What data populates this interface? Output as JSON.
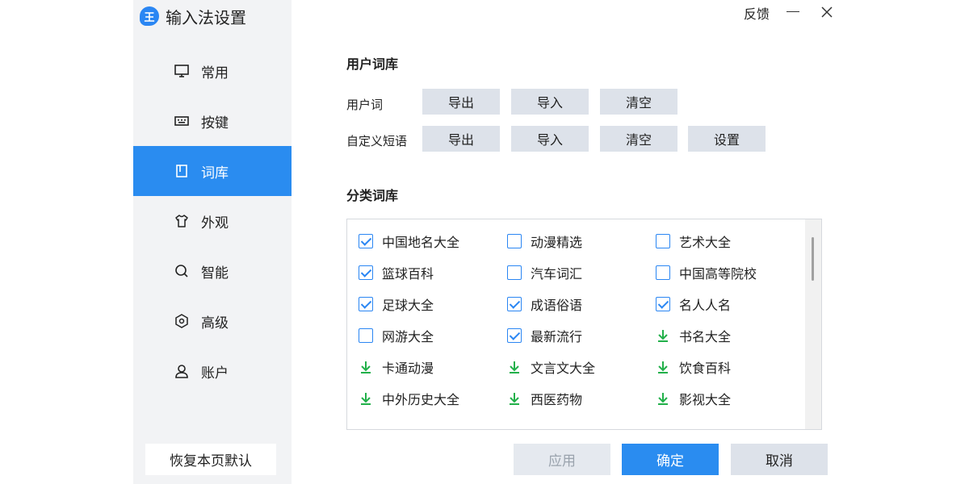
{
  "app": {
    "title": "输入法设置",
    "logo_text": "王"
  },
  "topbar": {
    "feedback": "反馈"
  },
  "sidebar": {
    "items": [
      {
        "label": "常用",
        "icon": "monitor-icon"
      },
      {
        "label": "按键",
        "icon": "keyboard-icon"
      },
      {
        "label": "词库",
        "icon": "book-icon",
        "active": true
      },
      {
        "label": "外观",
        "icon": "shirt-icon"
      },
      {
        "label": "智能",
        "icon": "search-icon"
      },
      {
        "label": "高级",
        "icon": "hexagon-icon"
      },
      {
        "label": "账户",
        "icon": "user-icon"
      }
    ],
    "restore_label": "恢复本页默认"
  },
  "user_lib": {
    "title": "用户词库",
    "rows": [
      {
        "label": "用户词",
        "buttons": [
          "导出",
          "导入",
          "清空"
        ]
      },
      {
        "label": "自定义短语",
        "buttons": [
          "导出",
          "导入",
          "清空",
          "设置"
        ]
      }
    ]
  },
  "category_lib": {
    "title": "分类词库",
    "items": [
      {
        "label": "中国地名大全",
        "state": "checked"
      },
      {
        "label": "动漫精选",
        "state": "unchecked"
      },
      {
        "label": "艺术大全",
        "state": "unchecked"
      },
      {
        "label": "篮球百科",
        "state": "checked"
      },
      {
        "label": "汽车词汇",
        "state": "unchecked"
      },
      {
        "label": "中国高等院校",
        "state": "unchecked"
      },
      {
        "label": "足球大全",
        "state": "checked"
      },
      {
        "label": "成语俗语",
        "state": "checked"
      },
      {
        "label": "名人人名",
        "state": "checked"
      },
      {
        "label": "网游大全",
        "state": "unchecked"
      },
      {
        "label": "最新流行",
        "state": "checked"
      },
      {
        "label": "书名大全",
        "state": "download"
      },
      {
        "label": "卡通动漫",
        "state": "download"
      },
      {
        "label": "文言文大全",
        "state": "download"
      },
      {
        "label": "饮食百科",
        "state": "download"
      },
      {
        "label": "中外历史大全",
        "state": "download"
      },
      {
        "label": "西医药物",
        "state": "download"
      },
      {
        "label": "影视大全",
        "state": "download"
      }
    ]
  },
  "footer": {
    "apply": "应用",
    "ok": "确定",
    "cancel": "取消"
  },
  "colors": {
    "accent": "#2a8cf0",
    "download": "#22b04a",
    "button": "#dde2ea",
    "sidebar_bg": "#f2f3f5"
  }
}
